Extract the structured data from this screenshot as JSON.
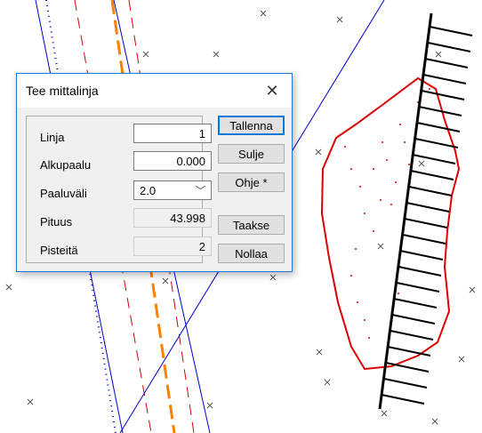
{
  "dialog": {
    "title": "Tee mittalinja",
    "close_glyph": "✕",
    "fields": {
      "linja": {
        "label": "Linja",
        "value": "1"
      },
      "alkupaalu": {
        "label": "Alkupaalu",
        "value": "0.000"
      },
      "paaluvali": {
        "label": "Paaluväli",
        "value": "2.0"
      },
      "pituus": {
        "label": "Pituus",
        "value": "43.998"
      },
      "pisteita": {
        "label": "Pisteitä",
        "value": "2"
      }
    },
    "buttons": {
      "tallenna": "Tallenna",
      "sulje": "Sulje",
      "ohje": "Ohje *",
      "taakse": "Taakse",
      "nollaa": "Nollaa"
    }
  },
  "colors": {
    "accent": "#0078d7",
    "road_edge": "#0000cc",
    "centerline": "#ff8000",
    "dashed_red": "#d00000",
    "area_outline": "#dd0000",
    "stake_lines": "#000000",
    "point_marks": "#555555"
  }
}
